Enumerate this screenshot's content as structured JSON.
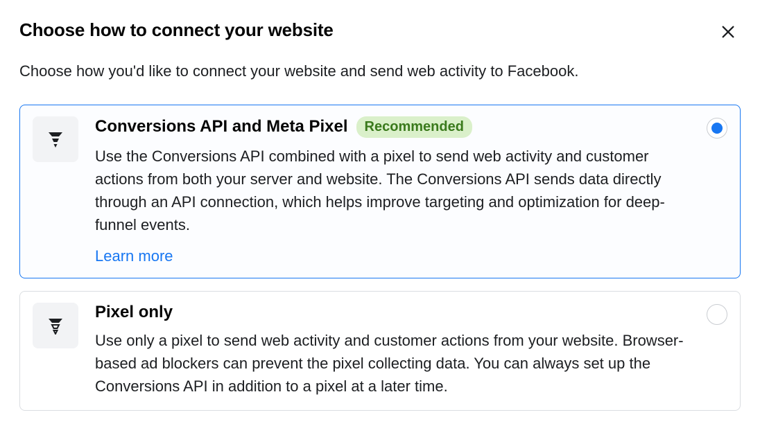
{
  "header": {
    "title": "Choose how to connect your website"
  },
  "subtitle": "Choose how you'd like to connect your website and send web activity to Facebook.",
  "options": [
    {
      "title": "Conversions API and Meta Pixel",
      "badge": "Recommended",
      "description": "Use the Conversions API combined with a pixel to send web activity and customer actions from both your server and website. The Conversions API sends data directly through an API connection, which helps improve targeting and optimization for deep-funnel events.",
      "learn_more": "Learn more",
      "selected": true
    },
    {
      "title": "Pixel only",
      "description": "Use only a pixel to send web activity and customer actions from your website. Browser-based ad blockers can prevent the pixel collecting data. You can always set up the Conversions API in addition to a pixel at a later time.",
      "selected": false
    }
  ]
}
